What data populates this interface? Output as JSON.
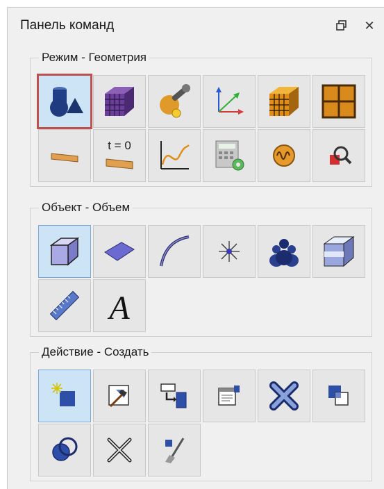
{
  "window": {
    "title": "Панель команд",
    "float_glyph": "🗗",
    "close_glyph": "✕"
  },
  "groups": [
    {
      "label": "Режим - Геометрия",
      "tools": [
        {
          "icon": "geometry-primitives-icon",
          "active": true,
          "highlighted": true
        },
        {
          "icon": "mesh-cube-purple-icon"
        },
        {
          "icon": "tools-wrench-icon"
        },
        {
          "icon": "coordinate-axes-icon"
        },
        {
          "icon": "mesh-cube-orange-icon"
        },
        {
          "icon": "grid-frame-icon"
        },
        {
          "icon": "plate-section-icon"
        },
        {
          "icon": "initial-condition-icon",
          "text": "t = 0"
        },
        {
          "icon": "graph-curve-icon"
        },
        {
          "icon": "calculator-settings-icon"
        },
        {
          "icon": "oscillator-icon"
        },
        {
          "icon": "inspect-zoom-icon"
        }
      ]
    },
    {
      "label": "Объект - Объем",
      "tools": [
        {
          "icon": "volume-cube-icon",
          "active": true
        },
        {
          "icon": "surface-face-icon"
        },
        {
          "icon": "edge-curve-icon"
        },
        {
          "icon": "vertex-point-icon"
        },
        {
          "icon": "group-objects-icon"
        },
        {
          "icon": "layered-cube-icon"
        },
        {
          "icon": "ruler-icon"
        },
        {
          "icon": "text-annotation-icon",
          "text": "A"
        }
      ]
    },
    {
      "label": "Действие - Создать",
      "tools": [
        {
          "icon": "create-new-icon",
          "active": true
        },
        {
          "icon": "modify-edit-icon"
        },
        {
          "icon": "transform-copy-icon"
        },
        {
          "icon": "properties-icon"
        },
        {
          "icon": "delete-icon"
        },
        {
          "icon": "duplicate-icon"
        },
        {
          "icon": "boolean-intersect-icon"
        },
        {
          "icon": "cut-split-icon"
        },
        {
          "icon": "clean-brush-icon"
        }
      ]
    }
  ],
  "colors": {
    "active_tool_bg": "#cde4f7",
    "highlight_outline": "#c0504d",
    "panel_bg": "#f0f0f0"
  }
}
